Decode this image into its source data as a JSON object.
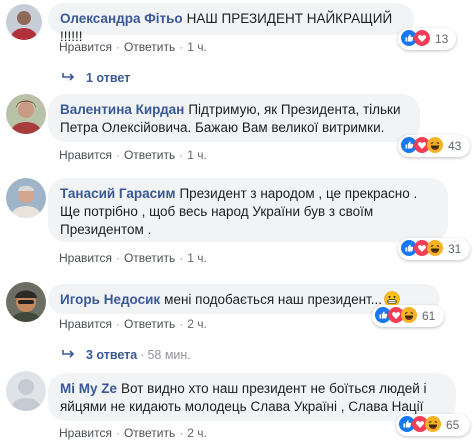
{
  "actions": {
    "like": "Нравится",
    "reply": "Ответить"
  },
  "comments": [
    {
      "author": "Олександра Фітьо",
      "text": "НАШ ПРЕЗИДЕНТ НАЙКРАЩИЙ !!!!!!",
      "time": "1 ч.",
      "reactions_count": "13",
      "reactions": [
        "like-icon",
        "love-icon"
      ]
    },
    {
      "author": "Валентина Кирдан",
      "text": "Підтримую, як Президента, тільки Петра Олексійовича. Бажаю Вам великої витримки.",
      "time": "1 ч.",
      "reactions_count": "43",
      "reactions": [
        "like-icon",
        "love-icon",
        "haha-icon"
      ]
    },
    {
      "author": "Танасий Гарасим",
      "text": "Президент з народом , це прекрасно . Ще потрібно , щоб весь народ України був з своїм Президентом .",
      "time": "1 ч.",
      "reactions_count": "31",
      "reactions": [
        "like-icon",
        "love-icon",
        "haha-icon"
      ]
    },
    {
      "author": "Игорь Недосик",
      "text": "мені подобається наш президент...",
      "emoji": "grinning-emoji",
      "time": "2 ч.",
      "reactions_count": "61",
      "reactions": [
        "like-icon",
        "love-icon",
        "haha-icon"
      ]
    },
    {
      "author": "Mi My Ze",
      "text": "Вот видно хто наш президент не боїться людей і яйцями не кидають молодець Слава Україні , Слава Нації",
      "time": "2 ч.",
      "reactions_count": "65",
      "reactions": [
        "like-icon",
        "love-icon",
        "haha-icon"
      ]
    }
  ],
  "reply_links": [
    {
      "text": "1 ответ",
      "time": ""
    },
    {
      "text": "3 ответа",
      "time": "58 мин."
    }
  ],
  "colors": {
    "link": "#385898",
    "like": "#1877f2",
    "love": "#f33e58",
    "haha": "#f7b125"
  }
}
